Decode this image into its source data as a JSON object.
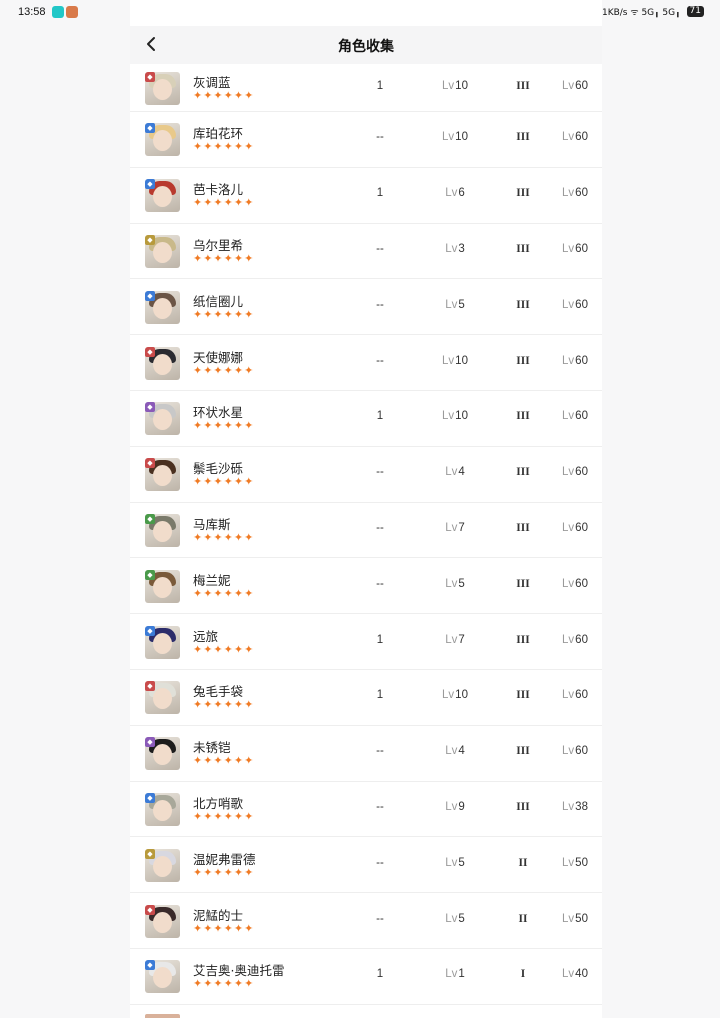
{
  "status_bar": {
    "time": "13:58",
    "indicators": "⊘ ✱ 0.21KB/s ᯤ 5G╻ 5G╻",
    "battery": "71"
  },
  "header": {
    "title": "角色收集",
    "back_icon": "chevron-left-icon"
  },
  "colors": {
    "star": "#f07b25",
    "divider": "#eeeeee"
  },
  "stars_text": "✦✦✦✦✦✦",
  "lv_prefix": "Lv",
  "rows": [
    {
      "name": "灰调蓝",
      "c1": "1",
      "lv": "10",
      "rank": "III",
      "maxlv": "60",
      "cls": "#c94b4b",
      "hair": "#d8d0b8"
    },
    {
      "name": "库珀花环",
      "c1": "--",
      "lv": "10",
      "rank": "III",
      "maxlv": "60",
      "cls": "#3c7bd6",
      "hair": "#e8c98a"
    },
    {
      "name": "芭卡洛儿",
      "c1": "1",
      "lv": "6",
      "rank": "III",
      "maxlv": "60",
      "cls": "#3c7bd6",
      "hair": "#b83a2e"
    },
    {
      "name": "乌尔里希",
      "c1": "--",
      "lv": "3",
      "rank": "III",
      "maxlv": "60",
      "cls": "#b89a3c",
      "hair": "#c9b98a"
    },
    {
      "name": "纸信圈儿",
      "c1": "--",
      "lv": "5",
      "rank": "III",
      "maxlv": "60",
      "cls": "#3c7bd6",
      "hair": "#6b5546"
    },
    {
      "name": "天使娜娜",
      "c1": "--",
      "lv": "10",
      "rank": "III",
      "maxlv": "60",
      "cls": "#c94b4b",
      "hair": "#2a2a30"
    },
    {
      "name": "环状水星",
      "c1": "1",
      "lv": "10",
      "rank": "III",
      "maxlv": "60",
      "cls": "#8a5ab8",
      "hair": "#c8c8c8"
    },
    {
      "name": "鬃毛沙砾",
      "c1": "--",
      "lv": "4",
      "rank": "III",
      "maxlv": "60",
      "cls": "#c94b4b",
      "hair": "#4a3020"
    },
    {
      "name": "马库斯",
      "c1": "--",
      "lv": "7",
      "rank": "III",
      "maxlv": "60",
      "cls": "#4a9a4a",
      "hair": "#7a7a6a"
    },
    {
      "name": "梅兰妮",
      "c1": "--",
      "lv": "5",
      "rank": "III",
      "maxlv": "60",
      "cls": "#4a9a4a",
      "hair": "#7a5a3a"
    },
    {
      "name": "远旅",
      "c1": "1",
      "lv": "7",
      "rank": "III",
      "maxlv": "60",
      "cls": "#3c7bd6",
      "hair": "#2c2c6a"
    },
    {
      "name": "兔毛手袋",
      "c1": "1",
      "lv": "10",
      "rank": "III",
      "maxlv": "60",
      "cls": "#c94b4b",
      "hair": "#e0e0d8"
    },
    {
      "name": "未锈铠",
      "c1": "--",
      "lv": "4",
      "rank": "III",
      "maxlv": "60",
      "cls": "#8a5ab8",
      "hair": "#1c1c1c"
    },
    {
      "name": "北方哨歌",
      "c1": "--",
      "lv": "9",
      "rank": "III",
      "maxlv": "38",
      "cls": "#3c7bd6",
      "hair": "#a8a89a"
    },
    {
      "name": "温妮弗雷德",
      "c1": "--",
      "lv": "5",
      "rank": "II",
      "maxlv": "50",
      "cls": "#b89a3c",
      "hair": "#d8d8e0"
    },
    {
      "name": "泥鯭的士",
      "c1": "--",
      "lv": "5",
      "rank": "II",
      "maxlv": "50",
      "cls": "#c94b4b",
      "hair": "#3a2a2a"
    },
    {
      "name": "艾吉奥·奥迪托雷",
      "c1": "1",
      "lv": "1",
      "rank": "I",
      "maxlv": "40",
      "cls": "#3c7bd6",
      "hair": "#e8e8e8"
    }
  ]
}
